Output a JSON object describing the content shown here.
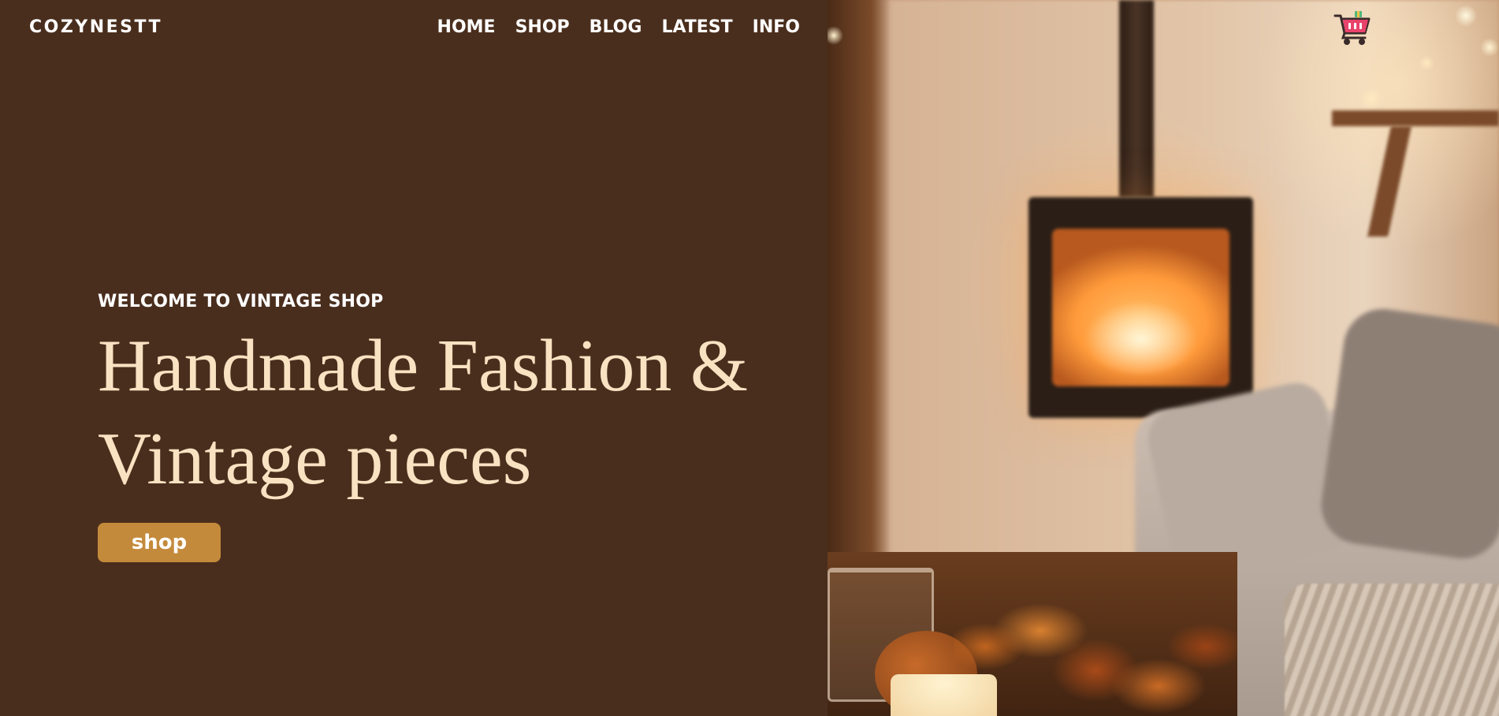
{
  "brand": {
    "name": "COZYNESTT"
  },
  "nav": {
    "items": [
      {
        "label": "HOME"
      },
      {
        "label": "SHOP"
      },
      {
        "label": "BLOG"
      },
      {
        "label": "LATEST"
      },
      {
        "label": "INFO"
      }
    ]
  },
  "hero": {
    "kicker": "WELCOME TO VINTAGE SHOP",
    "title_line1": "Handmade Fashion &",
    "title_line2": "Vintage pieces",
    "cta_label": "shop"
  },
  "cart": {
    "icon": "shopping-cart-icon"
  },
  "colors": {
    "panel_bg": "#4a2e1d",
    "title_text": "#f9e2c2",
    "cta_bg": "#c48a3b",
    "cart_pink": "#e8436b"
  }
}
